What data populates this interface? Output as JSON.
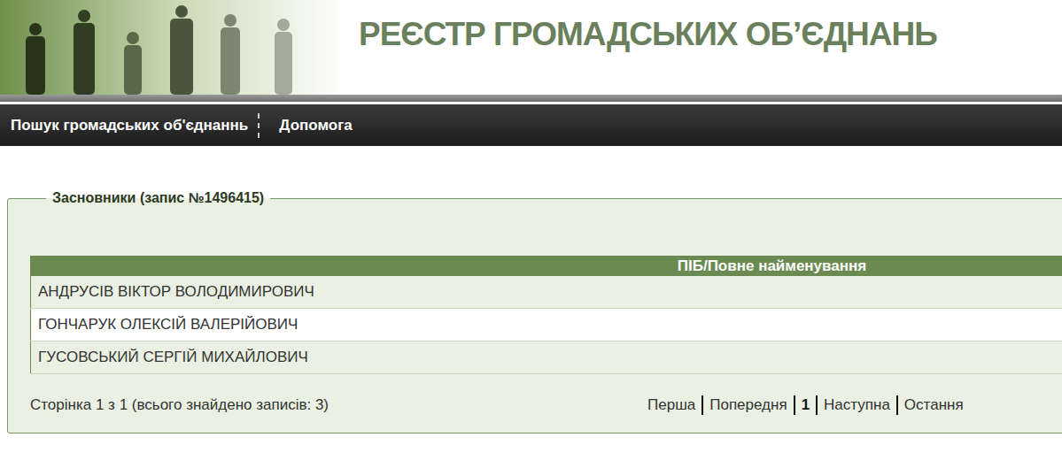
{
  "header": {
    "title": "РЕЄСТР ГРОМАДСЬКИХ ОБ’ЄДНАНЬ"
  },
  "nav": [
    {
      "label": "Пошук громадських об'єднаннь"
    },
    {
      "label": "Допомога"
    }
  ],
  "panel": {
    "legend": "Засновники (запис №1496415)"
  },
  "table": {
    "columns": [
      "ПІБ/Повне найменування"
    ],
    "rows": [
      [
        "АНДРУСІВ ВІКТОР ВОЛОДИМИРОВИЧ"
      ],
      [
        "ГОНЧАРУК ОЛЕКСІЙ ВАЛЕРІЙОВИЧ"
      ],
      [
        "ГУСОВСЬКИЙ СЕРГІЙ МИХАЙЛОВИЧ"
      ]
    ]
  },
  "pagination": {
    "info": "Сторінка 1 з 1 (всього знайдено записів: 3)",
    "links": [
      {
        "label": "Перша",
        "selected": false
      },
      {
        "label": "Попередня",
        "selected": false
      },
      {
        "label": "1",
        "selected": true
      },
      {
        "label": "Наступна",
        "selected": false
      },
      {
        "label": "Остання",
        "selected": false
      }
    ]
  }
}
